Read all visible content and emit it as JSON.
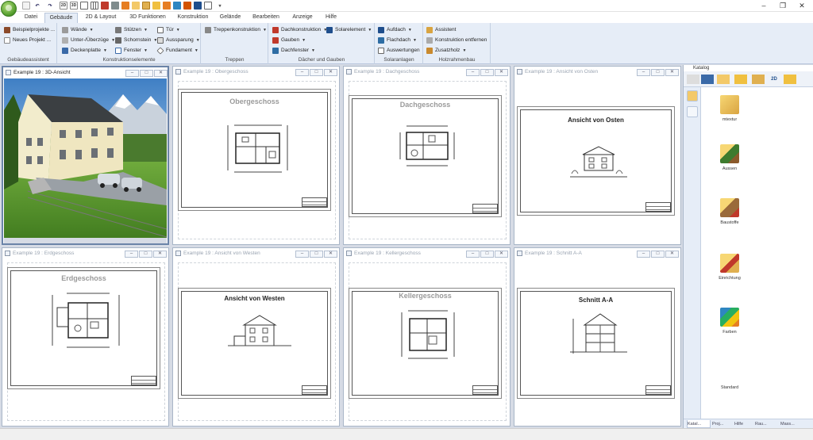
{
  "menu": {
    "tabs": [
      "Datei",
      "Gebäude",
      "2D & Layout",
      "3D Funktionen",
      "Konstruktion",
      "Gelände",
      "Bearbeiten",
      "Anzeige",
      "Hilfe"
    ],
    "active_tab": "Gebäude"
  },
  "ribbon": {
    "groups": {
      "gebaeudeassistent": {
        "label": "Gebäudeassistent",
        "items": [
          "Beispielprojekte ...",
          "Neues Projekt ..."
        ]
      },
      "konstruktionselemente": {
        "label": "Konstruktionselemente",
        "items": [
          "Wände",
          "Unter-/Überzüge",
          "Deckenplatte",
          "Stützen",
          "Schornstein",
          "Fenster",
          "Tür",
          "Aussparung",
          "Fundament"
        ]
      },
      "treppen": {
        "label": "Treppen",
        "items": [
          "Treppenkonstruktion"
        ]
      },
      "daecher": {
        "label": "Dächer und Gauben",
        "items": [
          "Dachkonstruktion",
          "Gauben",
          "Dachfenster",
          "Solarelement"
        ]
      },
      "solar": {
        "label": "Solaranlagen",
        "items": [
          "Aufdach",
          "Flachdach",
          "Auswertungen"
        ]
      },
      "holz": {
        "label": "Holzrahmenbau",
        "items": [
          "Assistent",
          "Konstruktion entfernen",
          "Zusatzholz"
        ]
      }
    }
  },
  "windows": [
    {
      "title": "Example 19 : 3D-Ansicht"
    },
    {
      "title": "Example 19 : Obergeschoss",
      "sheet_title": "Obergeschoss"
    },
    {
      "title": "Example 19 : Dachgeschoss",
      "sheet_title": "Dachgeschoss"
    },
    {
      "title": "Example 19 : Ansicht von Osten",
      "sheet_title": "Ansicht von Osten"
    },
    {
      "title": "Example 19 : Erdgeschoss",
      "sheet_title": "Erdgeschoss"
    },
    {
      "title": "Example 19 : Ansicht von Westen",
      "sheet_title": "Ansicht von Westen"
    },
    {
      "title": "Example 19 : Kellergeschoss",
      "sheet_title": "Kellergeschoss"
    },
    {
      "title": "Example 19 : Schnitt A-A",
      "sheet_title": "Schnitt A-A"
    }
  ],
  "catalog": {
    "title": "Katalog",
    "toolbar_2d": "2D",
    "items": [
      "mtextur",
      "Aussen",
      "Baustoffe",
      "Einrichtung",
      "Farben",
      "Standard"
    ],
    "tabs": [
      "Katal...",
      "Proj...",
      "Hilfe",
      "Rau...",
      "Mass..."
    ]
  },
  "colors": {
    "ribbon_bg": "#e6edf7",
    "workspace_bg": "#d6dbe5",
    "accent": "#6b84a8"
  }
}
